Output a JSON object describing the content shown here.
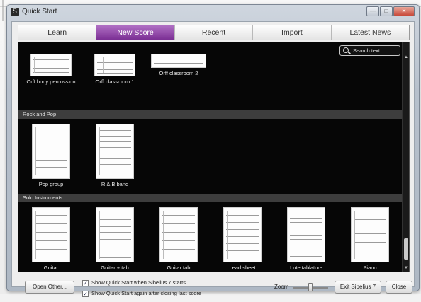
{
  "window": {
    "title": "Quick Start"
  },
  "tabs": [
    {
      "label": "Learn",
      "active": false
    },
    {
      "label": "New Score",
      "active": true
    },
    {
      "label": "Recent",
      "active": false
    },
    {
      "label": "Import",
      "active": false
    },
    {
      "label": "Latest News",
      "active": false
    }
  ],
  "search": {
    "placeholder": "Search text"
  },
  "sections": {
    "top_items": [
      "Orff body percussion",
      "Orff classroom 1",
      "Orff classroom 2"
    ],
    "rock_pop": {
      "title": "Rock and Pop",
      "items": [
        "Pop group",
        "R & B band"
      ]
    },
    "solo": {
      "title": "Solo Instruments",
      "items": [
        "Guitar",
        "Guitar + tab",
        "Guitar tab",
        "Lead sheet",
        "Lute tablature",
        "Piano"
      ]
    }
  },
  "footer": {
    "open_other": "Open Other...",
    "chk_show": "Show Quick Start when Sibelius 7 starts",
    "chk_show_again": "Show Quick Start again after closing last score",
    "zoom_label": "Zoom",
    "exit_button": "Exit Sibelius 7",
    "close_button": "Close"
  },
  "colors": {
    "active_tab": "#8a3ea4",
    "gallery_bg": "#060606"
  }
}
